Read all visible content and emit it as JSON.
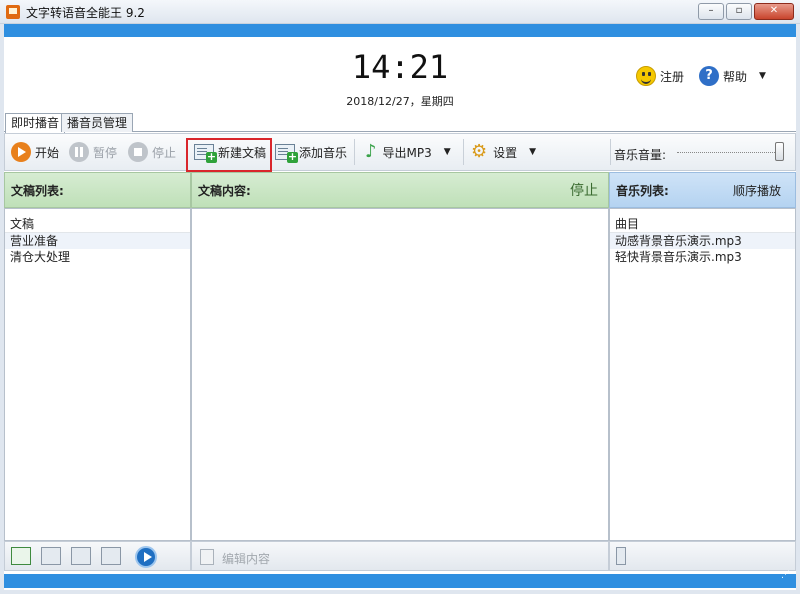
{
  "window": {
    "title": "文字转语音全能王 9.2",
    "buttons": [
      "–",
      "▫",
      "✕"
    ]
  },
  "header": {
    "time": "14:21",
    "date": "2018/12/27，星期四",
    "register_label": "注册",
    "help_label": "帮助"
  },
  "tabs": [
    {
      "label": "即时播音",
      "active": true
    },
    {
      "label": "播音员管理",
      "active": false
    }
  ],
  "toolbar": {
    "start": "开始",
    "pause": "暂停",
    "stop": "停止",
    "new_doc": "新建文稿",
    "add_music": "添加音乐",
    "export_mp3": "导出MP3",
    "settings": "设置",
    "volume_label": "音乐音量:",
    "volume_level": 1.0
  },
  "panels": {
    "doc_list": {
      "title": "文稿列表:",
      "column": "文稿",
      "items": [
        "营业准备",
        "清仓大处理"
      ]
    },
    "doc_content": {
      "title": "文稿内容:",
      "status": "停止",
      "edit_label": "编辑内容"
    },
    "music_list": {
      "title": "音乐列表:",
      "mode": "顺序播放",
      "column": "曲目",
      "items": [
        "动感背景音乐演示.mp3",
        "轻快背景音乐演示.mp3"
      ]
    }
  },
  "colors": {
    "accent_blue": "#2f8fe0",
    "start_orange": "#e8801c",
    "highlight_red": "#d9262c"
  }
}
